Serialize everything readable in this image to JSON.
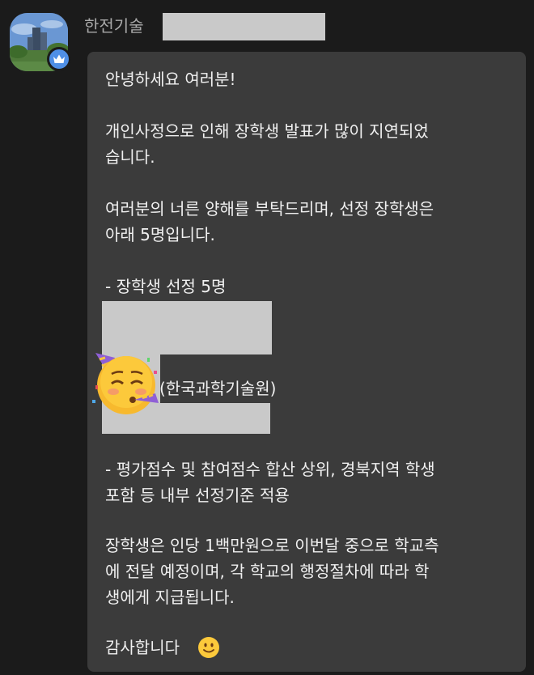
{
  "sender": {
    "name": "한전기술",
    "avatar_icon": "building-photo-avatar",
    "badge_icon": "crown-icon",
    "badge_color": "#4f8fe6"
  },
  "message": {
    "greeting": "안녕하세요 여러분!",
    "p1_line1": "개인사정으로 인해 장학생 발표가 많이 지연되었",
    "p1_line2": "습니다.",
    "p2_line1": "여러분의 너른 양해를 부탁드리며, 선정 장학생은",
    "p2_line2": "아래 5명입니다.",
    "selection_heading": "- 장학생 선정 5명",
    "party_emoji": "partying-face-emoji",
    "institute": "(한국과학기술원)",
    "criteria_line1": "- 평가점수 및 참여점수 합산 상위, 경북지역 학생",
    "criteria_line2": "포함 등 내부 선정기준 적용",
    "payment_line1": "장학생은 인당 1백만원으로 이번달 중으로 학교측",
    "payment_line2": "에 전달 예정이며, 각 학교의 행정절차에 따라 학",
    "payment_line3": "생에게 지급됩니다.",
    "closing": "감사합니다",
    "closing_emoji": "slightly-smiling-face-emoji"
  },
  "colors": {
    "background": "#1b1b1b",
    "bubble": "#3b3b3b",
    "text": "#f0f0f0",
    "sender_text": "#a9a9a9",
    "redaction": "#c9c9c9"
  }
}
